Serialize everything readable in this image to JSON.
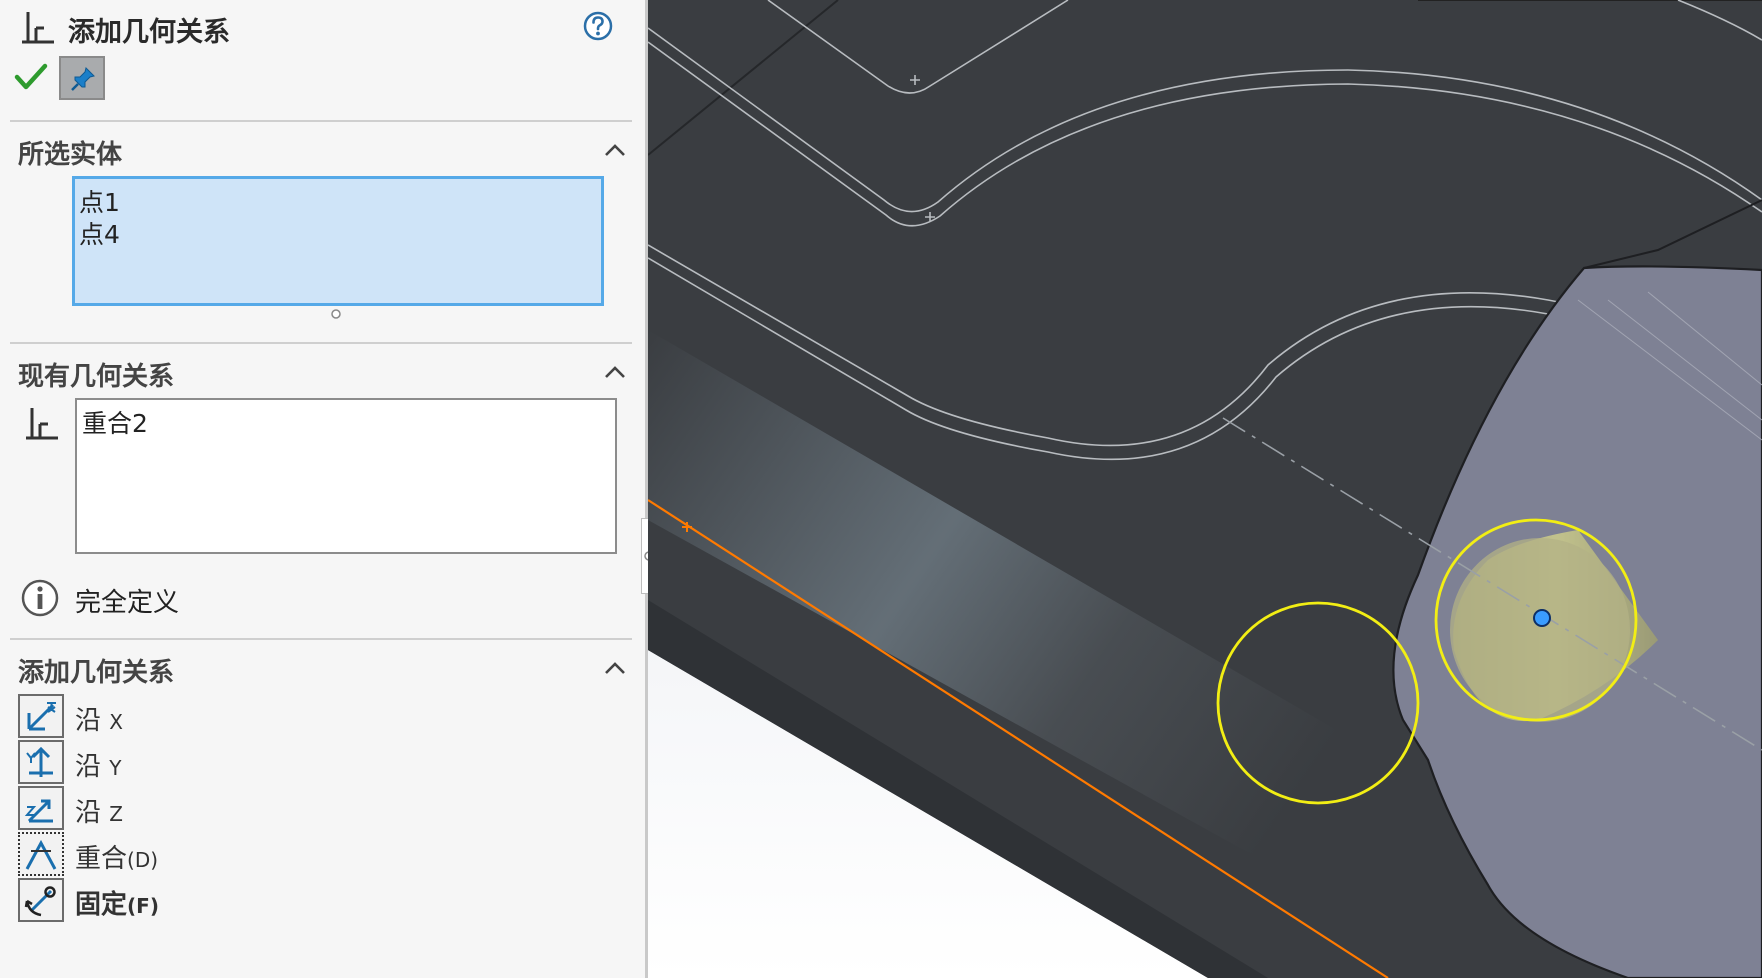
{
  "header": {
    "title": "添加几何关系"
  },
  "sections": {
    "selected_entities": {
      "title": "所选实体",
      "items": [
        "点1",
        "点4"
      ]
    },
    "existing_relations": {
      "title": "现有几何关系",
      "items": [
        "重合2"
      ],
      "status_text": "完全定义"
    },
    "add_relations": {
      "title": "添加几何关系",
      "items": [
        {
          "label": "沿",
          "suffix": "X"
        },
        {
          "label": "沿",
          "suffix": "Y"
        },
        {
          "label": "沿",
          "suffix": "Z"
        },
        {
          "label": "重合",
          "suffix": "(D)"
        },
        {
          "label": "固定",
          "suffix": "(F)"
        }
      ]
    }
  },
  "colors": {
    "ok": "#2e9b2e",
    "accent": "#1b7fc9",
    "highlight": "#f2ee14",
    "edge": "#ff7a00",
    "face": "#7e8194",
    "body": "#3a3d41"
  }
}
